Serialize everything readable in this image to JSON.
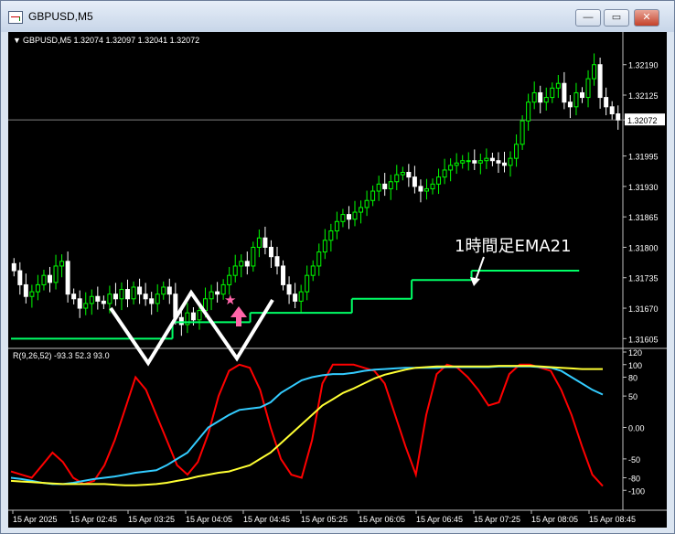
{
  "window": {
    "title": "GBPUSD,M5",
    "buttons": {
      "minimize": "—",
      "maximize": "▭",
      "close": "✕"
    }
  },
  "colors": {
    "background": "#000000",
    "bull_candle": "#00ff00",
    "bear_candle": "#ffffff",
    "ema_line": "#00ff66",
    "rci_short": "#ff0000",
    "rci_mid": "#33ccff",
    "rci_long": "#ffff33",
    "annotation": "#ffffff",
    "marker": "#ff66aa"
  },
  "chart_data": [
    {
      "type": "candlestick",
      "title": "GBPUSD,M5  1.32074 1.32097 1.32041 1.32072",
      "symbol": "GBPUSD,M5",
      "ohlc_header": "1.32074 1.32097 1.32041 1.32072",
      "ylim": [
        1.3159,
        1.3225
      ],
      "price_ticks": [
        "1.32190",
        "1.32125",
        "1.32072",
        "1.31995",
        "1.31930",
        "1.31865",
        "1.31800",
        "1.31735",
        "1.31670",
        "1.31605"
      ],
      "current_price": "1.32072",
      "candles_close": [
        1.3175,
        1.3172,
        1.31695,
        1.31705,
        1.3172,
        1.3174,
        1.31725,
        1.3176,
        1.3177,
        1.317,
        1.3169,
        1.3167,
        1.3168,
        1.31695,
        1.31685,
        1.3168,
        1.317,
        1.3169,
        1.3171,
        1.3169,
        1.31715,
        1.317,
        1.3169,
        1.3168,
        1.317,
        1.31715,
        1.317,
        1.3165,
        1.31635,
        1.3166,
        1.31645,
        1.31665,
        1.3169,
        1.31705,
        1.317,
        1.3172,
        1.3174,
        1.3176,
        1.3177,
        1.3176,
        1.318,
        1.3182,
        1.318,
        1.3178,
        1.3176,
        1.3172,
        1.317,
        1.31685,
        1.31705,
        1.3174,
        1.3176,
        1.3179,
        1.31815,
        1.31835,
        1.31855,
        1.3187,
        1.3186,
        1.31875,
        1.31885,
        1.319,
        1.3192,
        1.31935,
        1.31925,
        1.3194,
        1.31955,
        1.3196,
        1.3195,
        1.3193,
        1.3192,
        1.31925,
        1.31935,
        1.3195,
        1.31965,
        1.31975,
        1.3198,
        1.31985,
        1.31985,
        1.3198,
        1.31985,
        1.3199,
        1.31985,
        1.3198,
        1.31975,
        1.3199,
        1.3202,
        1.3207,
        1.3211,
        1.3213,
        1.3211,
        1.3212,
        1.3214,
        1.3215,
        1.3211,
        1.321,
        1.3213,
        1.3212,
        1.3216,
        1.3219,
        1.3212,
        1.321,
        1.32085,
        1.32072
      ],
      "ema_label": "1時間足EMA21",
      "ema_steps": [
        {
          "from": 0,
          "to": 27,
          "value": 1.31605
        },
        {
          "from": 27,
          "to": 40,
          "value": 1.3164
        },
        {
          "from": 40,
          "to": 57,
          "value": 1.3166
        },
        {
          "from": 57,
          "to": 67,
          "value": 1.3169
        },
        {
          "from": 67,
          "to": 77,
          "value": 1.3173
        },
        {
          "from": 77,
          "to": 95,
          "value": 1.3175
        }
      ]
    },
    {
      "type": "line",
      "title": "R(9,26,52) -93.3 52.3 93.0",
      "ylim": [
        -120,
        120
      ],
      "y_ticks": [
        "120",
        "100",
        "80",
        "50",
        "0.00",
        "-50",
        "-80",
        "-100"
      ],
      "x_ticks": [
        "15 Apr 2025",
        "15 Apr 02:45",
        "15 Apr 03:25",
        "15 Apr 04:05",
        "15 Apr 04:45",
        "15 Apr 05:25",
        "15 Apr 06:05",
        "15 Apr 06:45",
        "15 Apr 07:25",
        "15 Apr 08:05",
        "15 Apr 08:45"
      ],
      "series": [
        {
          "name": "9",
          "values": [
            -70,
            -75,
            -80,
            -60,
            -40,
            -55,
            -80,
            -90,
            -85,
            -60,
            -20,
            30,
            80,
            60,
            20,
            -20,
            -60,
            -75,
            -55,
            -10,
            50,
            90,
            100,
            95,
            60,
            0,
            -50,
            -75,
            -80,
            -20,
            70,
            100,
            100,
            100,
            95,
            90,
            70,
            20,
            -30,
            -75,
            20,
            85,
            100,
            95,
            80,
            60,
            35,
            40,
            85,
            100,
            100,
            95,
            90,
            60,
            20,
            -30,
            -75,
            -93.3
          ]
        },
        {
          "name": "26",
          "values": [
            -80,
            -82,
            -85,
            -88,
            -90,
            -90,
            -88,
            -85,
            -82,
            -80,
            -78,
            -75,
            -72,
            -70,
            -68,
            -60,
            -50,
            -40,
            -20,
            0,
            10,
            20,
            28,
            30,
            32,
            40,
            55,
            65,
            75,
            80,
            83,
            85,
            85,
            87,
            90,
            92,
            93,
            94,
            95,
            95,
            95,
            95,
            96,
            96,
            96,
            96,
            96,
            97,
            97,
            97,
            97,
            96,
            95,
            90,
            80,
            70,
            60,
            52.3
          ]
        },
        {
          "name": "52",
          "values": [
            -85,
            -86,
            -87,
            -88,
            -89,
            -90,
            -90,
            -90,
            -90,
            -90,
            -91,
            -92,
            -92,
            -91,
            -90,
            -88,
            -85,
            -82,
            -78,
            -75,
            -72,
            -70,
            -65,
            -60,
            -50,
            -40,
            -25,
            -10,
            5,
            20,
            35,
            45,
            55,
            62,
            70,
            78,
            84,
            88,
            92,
            95,
            96,
            97,
            97,
            97,
            97,
            97,
            97,
            98,
            98,
            98,
            98,
            97,
            96,
            95,
            94,
            93,
            93,
            93.0
          ]
        }
      ]
    }
  ]
}
